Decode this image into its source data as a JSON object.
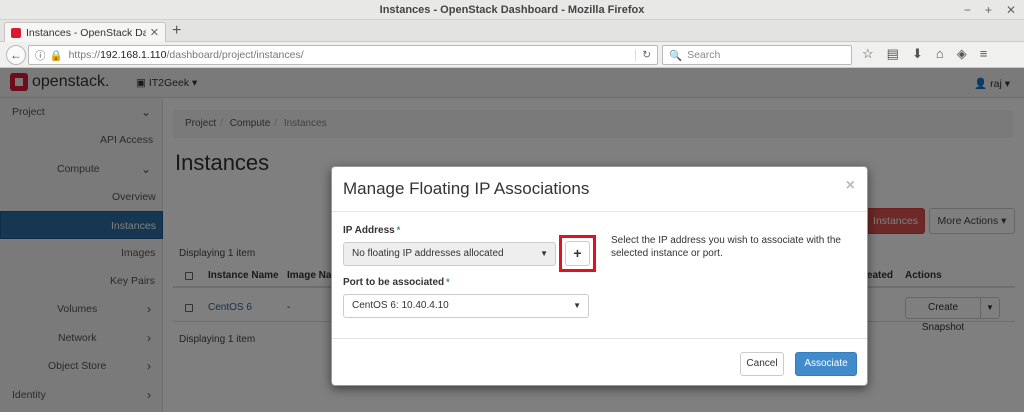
{
  "window": {
    "title": "Instances - OpenStack Dashboard - Mozilla Firefox",
    "controls": [
      "−",
      "+",
      "✕"
    ]
  },
  "browser": {
    "tab_title": "Instances - OpenStack Dash",
    "url_host": "192.168.1.110",
    "url_prefix": "https://",
    "url_path": "/dashboard/project/instances/",
    "search_placeholder": "Search"
  },
  "header": {
    "logo_text": "openstack.",
    "project_selector": "IT2Geek ▾",
    "user_menu": "raj ▾"
  },
  "sidebar": {
    "items": [
      {
        "label": "Project",
        "chev": "⌄"
      },
      {
        "label": "API Access",
        "chev": ""
      },
      {
        "label": "Compute",
        "chev": "⌄"
      },
      {
        "label": "Overview",
        "chev": ""
      },
      {
        "label": "Instances",
        "chev": ""
      },
      {
        "label": "Images",
        "chev": ""
      },
      {
        "label": "Key Pairs",
        "chev": ""
      },
      {
        "label": "Volumes",
        "chev": "›"
      },
      {
        "label": "Network",
        "chev": "›"
      },
      {
        "label": "Object Store",
        "chev": "›"
      },
      {
        "label": "Identity",
        "chev": "›"
      }
    ]
  },
  "main": {
    "breadcrumb": [
      "Project",
      "Compute",
      "Instances"
    ],
    "page_title": "Instances",
    "launch_button": "Instances",
    "more_actions_button": "More Actions ▾",
    "displaying_top": "Displaying 1 item",
    "displaying_bottom": "Displaying 1 item",
    "columns": [
      "Instance Name",
      "Image Na",
      "reated",
      "Actions"
    ],
    "rows": [
      {
        "name": "CentOS 6",
        "image": "-",
        "action": "Create Snapshot"
      }
    ]
  },
  "modal": {
    "title": "Manage Floating IP Associations",
    "close": "×",
    "ip_label": "IP Address",
    "ip_value": "No floating IP addresses allocated",
    "port_label": "Port to be associated",
    "port_value": "CentOS 6: 10.40.4.10",
    "required_mark": "*",
    "help_text": "Select the IP address you wish to associate with the selected instance or port.",
    "plus_label": "+",
    "cancel_label": "Cancel",
    "associate_label": "Associate"
  },
  "colors": {
    "primary": "#428bca",
    "danger": "#d9534f",
    "highlight": "#e0121f",
    "sidebar_active": "#2e6da4"
  }
}
